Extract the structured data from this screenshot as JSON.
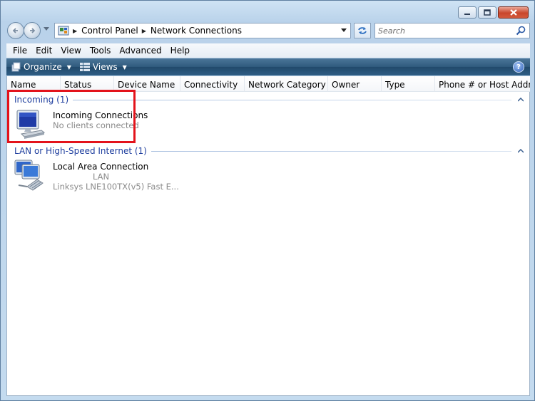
{
  "window": {
    "controls": {
      "minimize_icon": "minimize-icon",
      "maximize_icon": "maximize-icon",
      "close_icon": "close-icon"
    }
  },
  "address_bar": {
    "breadcrumbs": [
      "Control Panel",
      "Network Connections"
    ],
    "search_placeholder": "Search"
  },
  "menu": {
    "items": [
      "File",
      "Edit",
      "View",
      "Tools",
      "Advanced",
      "Help"
    ]
  },
  "command_bar": {
    "organize_label": "Organize",
    "views_label": "Views",
    "help_label": "?"
  },
  "columns": [
    "Name",
    "Status",
    "Device Name",
    "Connectivity",
    "Network Category",
    "Owner",
    "Type",
    "Phone # or Host Addre..."
  ],
  "groups": [
    {
      "title": "Incoming (1)",
      "items": [
        {
          "name": "Incoming Connections",
          "line1": "No clients connected",
          "icon": "monitor-icon"
        }
      ]
    },
    {
      "title": "LAN or High-Speed Internet (1)",
      "items": [
        {
          "name": "Local Area Connection",
          "line1": "LAN",
          "line2": "Linksys LNE100TX(v5) Fast E...",
          "icon": "network-adapter-icon"
        }
      ]
    }
  ],
  "colors": {
    "group_title": "#1e3e9e",
    "highlight": "#e3131b",
    "command_bar": "#2f5a7d"
  }
}
